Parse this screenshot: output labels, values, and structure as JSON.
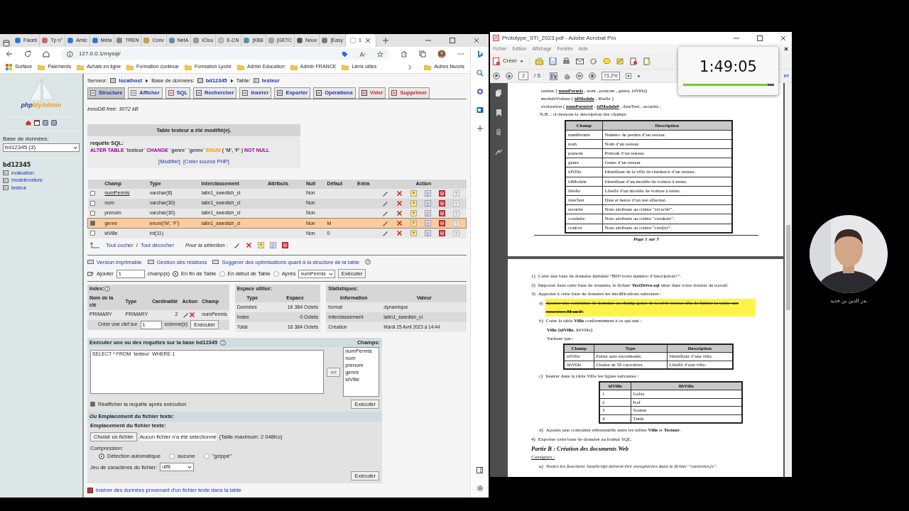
{
  "browser": {
    "tabs": [
      {
        "label": "Faceb",
        "selected": false
      },
      {
        "label": "Tp n°",
        "selected": false
      },
      {
        "label": "Amic",
        "selected": false
      },
      {
        "label": "Meta",
        "selected": false
      },
      {
        "label": "TREN",
        "selected": false
      },
      {
        "label": "Conv",
        "selected": false
      },
      {
        "label": "NetA",
        "selected": false
      },
      {
        "label": "iClou",
        "selected": false
      },
      {
        "label": "E-CN",
        "selected": false
      },
      {
        "label": "[KB8",
        "selected": false
      },
      {
        "label": "[GETC",
        "selected": false
      },
      {
        "label": "Nouv",
        "selected": false
      },
      {
        "label": "[Easy",
        "selected": false
      },
      {
        "label": "1",
        "selected": true
      }
    ],
    "address": "127.0.0.1/mysql/",
    "bookmarks": [
      "Surface",
      "Paiements",
      "Achats en ligne",
      "Formation continue",
      "Formation Lycée",
      "Admin Education",
      "Admin FRANCE",
      "Liens utiles"
    ],
    "other_bookmarks": "Autres favoris"
  },
  "pma": {
    "logo": [
      "php",
      "MyAdmin"
    ],
    "db_label": "Base de données:",
    "db_select": "bd12345 (3)",
    "db_name": "bd12345",
    "tables": [
      "evaluation",
      "modelevoiture",
      "testeur"
    ],
    "breadcrumb": [
      {
        "label": "Serveur:",
        "value": "localhost"
      },
      {
        "label": "Base de données:",
        "value": "bd12345"
      },
      {
        "label": "Table:",
        "value": "testeur"
      }
    ],
    "tabs": [
      {
        "label": "Structure",
        "selected": true,
        "kind": "normal"
      },
      {
        "label": "Afficher",
        "selected": false,
        "kind": "normal"
      },
      {
        "label": "SQL",
        "selected": false,
        "kind": "normal"
      },
      {
        "label": "Rechercher",
        "selected": false,
        "kind": "normal"
      },
      {
        "label": "Insérer",
        "selected": false,
        "kind": "normal"
      },
      {
        "label": "Exporter",
        "selected": false,
        "kind": "normal"
      },
      {
        "label": "Opérations",
        "selected": false,
        "kind": "normal"
      },
      {
        "label": "Vider",
        "selected": false,
        "kind": "danger"
      },
      {
        "label": "Supprimer",
        "selected": false,
        "kind": "danger"
      }
    ],
    "engine_info": "InnoDB free: 3072 kB",
    "message": {
      "title": "Table testeur a été modifié(e).",
      "sql_label": "requête SQL:",
      "sql": [
        {
          "text": "ALTER TABLE",
          "kind": "keyword"
        },
        {
          "text": "`testeur`",
          "kind": "name"
        },
        {
          "text": "CHANGE",
          "kind": "keyword"
        },
        {
          "text": "`genre`",
          "kind": "name"
        },
        {
          "text": "`genre`",
          "kind": "name"
        },
        {
          "text": "ENUM",
          "kind": "function"
        },
        {
          "text": "( 'M', 'F' )",
          "kind": "name"
        },
        {
          "text": "NOT NULL",
          "kind": "keyword"
        }
      ],
      "links": [
        "[Modifier]",
        "[Créer source PHP]"
      ]
    },
    "structure": {
      "columns": [
        "Champ",
        "Type",
        "Interclassement",
        "Attributs",
        "Null",
        "Défaut",
        "Extra",
        "Action"
      ],
      "rows": [
        {
          "name": "numPermis",
          "primary": true,
          "type": "varchar(8)",
          "collation": "latin1_swedish_ci",
          "null": "Non",
          "checked": false
        },
        {
          "name": "nom",
          "primary": false,
          "type": "varchar(30)",
          "collation": "latin1_swedish_ci",
          "null": "Non",
          "checked": false
        },
        {
          "name": "prenom",
          "primary": false,
          "type": "varchar(30)",
          "collation": "latin1_swedish_ci",
          "null": "Non",
          "checked": false
        },
        {
          "name": "genre",
          "primary": false,
          "type": "enum('M', 'F')",
          "collation": "latin1_swedish_ci",
          "null": "Non",
          "default": "M",
          "checked": true
        },
        {
          "name": "idVille",
          "primary": false,
          "type": "int(11)",
          "null": "Non",
          "default": "0",
          "checked": false
        }
      ]
    },
    "check_all": "Tout cocher",
    "separator": "/",
    "uncheck_all": "Tout décocher",
    "selection_label": "Pour la sélection :",
    "links": [
      "Version imprimable",
      "Gestion des relations",
      "Suggérer des optimisations quant à la structure de la table"
    ],
    "add": {
      "label": "Ajouter",
      "value": "1",
      "unit": "champ(s)",
      "options": [
        {
          "label": "En fin de Table",
          "selected": true
        },
        {
          "label": "En début de Table",
          "selected": false
        },
        {
          "label": "Après",
          "selected": false
        }
      ],
      "after": "numPermis",
      "button": "Exécuter"
    },
    "index": {
      "title": "Index:",
      "columns": [
        "Nom de la clé",
        "Type",
        "Cardinalité",
        "Action",
        "Champ"
      ],
      "row": {
        "name": "PRIMARY",
        "type": "PRIMARY",
        "cardinality": "2",
        "field": "numPermis"
      },
      "create_label": "Créer une clef sur",
      "create_value": "1",
      "create_unit": "colonne(s)",
      "button": "Exécuter"
    },
    "space": {
      "title": "Espace utilisé:",
      "columns": [
        "Type",
        "Espace"
      ],
      "rows": [
        [
          "Données",
          "16 384 Octets"
        ],
        [
          "Index",
          "0 Octets"
        ],
        [
          "Total",
          "16 384 Octets"
        ]
      ]
    },
    "stats": {
      "title": "Statistiques:",
      "columns": [
        "Information",
        "Valeur"
      ],
      "rows": [
        [
          "format",
          "dynamique"
        ],
        [
          "Interclassement",
          "latin1_swedish_ci"
        ],
        [
          "Création",
          "Mardi 25 Avril 2023 à 14:44"
        ]
      ]
    },
    "query": {
      "title": "Exécuter une ou des requêtes sur la base bd12345",
      "text": "SELECT * FROM `testeur` WHERE 1",
      "fields_label": "Champs:",
      "fields": [
        "numPermis",
        "nom",
        "prenom",
        "genre",
        "idVille"
      ],
      "insert": "<<",
      "redisplay": {
        "label": "Réafficher la requête après exécution",
        "checked": true
      },
      "button": "Exécuter"
    },
    "file": {
      "title": "*Ou* Emplacement du fichier texte:",
      "subtitle": "Emplacement du fichier texte:",
      "choose": "Choisir un fichier",
      "status": "Aucun fichier n'a été sélectionné",
      "limit": "(Taille maximum: 2 048Ko)",
      "compression_label": "Compression:",
      "compression": [
        {
          "label": "Détection automatique",
          "selected": true
        },
        {
          "label": "aucune",
          "selected": false
        },
        {
          "label": "\"gzippé\"",
          "selected": false
        }
      ],
      "charset_label": "Jeu de caractères du fichier:",
      "charset": "utf8",
      "button": "Exécuter"
    },
    "footer_link": "Insérer des données provenant d'un fichier texte dans la table"
  },
  "acrobat": {
    "title": "Prototype_STI_2023.pdf - Adobe Acrobat Pro",
    "menu": [
      "Fichier",
      "Edition",
      "Affichage",
      "Fenêtre",
      "Aide"
    ],
    "create": "Créer",
    "page": "2",
    "pages": "/ 5",
    "zoom": "73,2%",
    "side_button": "er",
    "page1": [
      {
        "kind": "schema",
        "text": "testeur ( **numPermis** , nom , prenom , genre, idVille)"
      },
      {
        "kind": "schema",
        "text": "modeleVoiture ( **idModele** , libelle )"
      },
      {
        "kind": "schema",
        "text": "evaluation ( **numPermis#** , **idModele#** , dateTest , securite ,"
      },
      {
        "kind": "line",
        "text": "N.B. : ci-dessous la description des champs"
      },
      {
        "kind": "table",
        "columns": [
          "Champ",
          "Description"
        ],
        "rows": [
          [
            "numPermis",
            "Numéro de permis d’un testeur."
          ],
          [
            "nom",
            "Nom d’un testeur."
          ],
          [
            "prenom",
            "Prénom d’un testeur."
          ],
          [
            "genre",
            "Genre d’un testeur"
          ],
          [
            "idVille",
            "Identifiant de la ville de résidence d’un testeur."
          ],
          [
            "idModele",
            "Identifiant d’un modèle de voiture à tester."
          ],
          [
            "libelle",
            "Libellé d’un modèle de voiture à tester."
          ],
          [
            "dateTest",
            "Date et heure d’un test effectué."
          ],
          [
            "securite",
            "Note attribuée au critère \"*sécurité*\"."
          ],
          [
            "conduite",
            "Note attribuée au critère \"*conduite*\"."
          ],
          [
            "confort",
            "Note attribuée au critère \"*confort*\"."
          ]
        ]
      },
      {
        "kind": "footer",
        "text": "Page 1 sur 5"
      }
    ],
    "page2": [
      {
        "kind": "item",
        "marker": "1)",
        "text": "Créer une base de données intitulée \"BD<votre numéro d’inscription>\"."
      },
      {
        "kind": "item",
        "marker": "2)",
        "text": "Importer dans cette base de données, le fichier **TestDrive.sql** situé dans votre dossier de travail."
      },
      {
        "kind": "item",
        "marker": "3)",
        "text": "Apporter à cette base de données les modifications suivantes :"
      },
      {
        "kind": "subitem",
        "marker": "a)",
        "text": "Ajouter une contrainte de domaine au champ genre de la table testeur afin de limiter la saisie aux caractères **M ou F**.",
        "highlighted": true
      },
      {
        "kind": "subitem",
        "marker": "b)",
        "text": "Créer la table **Ville** conformément à ce qui suit :",
        "highlighted": false
      },
      {
        "kind": "line",
        "text": "**Ville** (**idVille**, libVille)"
      },
      {
        "kind": "line",
        "text": "Sachant que :"
      },
      {
        "kind": "table",
        "columns": [
          "Champ",
          "Type",
          "Description"
        ],
        "rows": [
          [
            "idVille",
            "Entier auto-incrémenté.",
            "Identifiant d’une ville."
          ],
          [
            "libVille",
            "Chaine de 50 caractères.",
            "Libellé d’une ville."
          ]
        ]
      },
      {
        "kind": "subitem",
        "marker": "c)",
        "text": "Insérer dans la table Ville les lignes suivantes :",
        "highlighted": false
      },
      {
        "kind": "table",
        "columns": [
          "idVille",
          "libVille"
        ],
        "rows": [
          [
            "1",
            "Gafsa"
          ],
          [
            "2",
            "Kef"
          ],
          [
            "3",
            "Sousse"
          ],
          [
            "4",
            "Tunis"
          ]
        ]
      },
      {
        "kind": "subitem",
        "marker": "d)",
        "text": "Ajouter une contrainte référentielle entre les tables **Ville** et **Testeur**.",
        "highlighted": false
      },
      {
        "kind": "item",
        "marker": "4)",
        "text": "Exporter cette base de données au format SQL."
      },
      {
        "kind": "heading",
        "text": "Partie B : Création des documents Web"
      },
      {
        "kind": "subheading",
        "text": "Consignes :"
      },
      {
        "kind": "note",
        "marker": "a)",
        "text": "Toutes les fonctions JavaScript doivent être enregistrées dans le fichier \"controles.js\"."
      }
    ]
  },
  "timer": {
    "time": "1:49:05",
    "level": 0.93
  },
  "webcam": {
    "name": "بدر الدين بن حديد"
  }
}
